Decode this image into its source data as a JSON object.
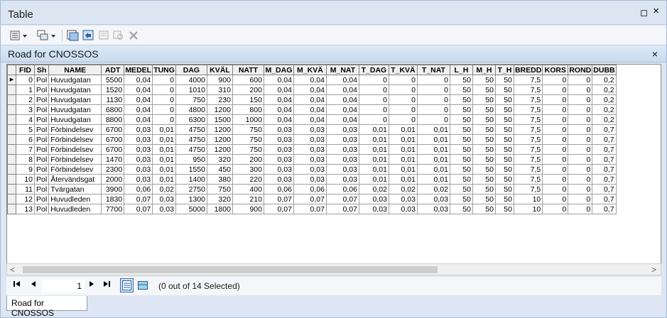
{
  "window": {
    "title": "Table",
    "restore_glyph": "◻",
    "close_glyph": "×"
  },
  "toolbar": {
    "icons": [
      "table-options-icon",
      "related-tables-icon",
      "select-by-attributes-icon",
      "switch-selection-icon",
      "clear-selection-icon",
      "zoom-to-selected-icon",
      "delete-selected-icon"
    ]
  },
  "layer": {
    "name": "Road for CNOSSOS",
    "close_glyph": "×"
  },
  "grid": {
    "columns": [
      "FID",
      "Sh",
      "NAME",
      "ADT",
      "MEDEL",
      "TUNG",
      "DAG",
      "KVÄL",
      "NATT",
      "M_DAG",
      "M_KVÄ",
      "M_NAT",
      "T_DAG",
      "T_KVÄ",
      "T_NAT",
      "L_H",
      "M_H",
      "T_H",
      "BREDD",
      "KORS",
      "ROND",
      "DUBB"
    ],
    "rows": [
      [
        "0",
        "Pol",
        "Huvudgatan",
        "5500",
        "0,04",
        "0",
        "4000",
        "900",
        "600",
        "0,04",
        "0,04",
        "0,04",
        "0",
        "0",
        "0",
        "50",
        "50",
        "50",
        "7,5",
        "0",
        "0",
        "0,2"
      ],
      [
        "1",
        "Pol",
        "Huvudgatan",
        "1520",
        "0,04",
        "0",
        "1010",
        "310",
        "200",
        "0,04",
        "0,04",
        "0,04",
        "0",
        "0",
        "0",
        "50",
        "50",
        "50",
        "7,5",
        "0",
        "0",
        "0,2"
      ],
      [
        "2",
        "Pol",
        "Huvudgatan",
        "1130",
        "0,04",
        "0",
        "750",
        "230",
        "150",
        "0,04",
        "0,04",
        "0,04",
        "0",
        "0",
        "0",
        "50",
        "50",
        "50",
        "7,5",
        "0",
        "0",
        "0,2"
      ],
      [
        "3",
        "Pol",
        "Huvudgatan",
        "6800",
        "0,04",
        "0",
        "4800",
        "1200",
        "800",
        "0,04",
        "0,04",
        "0,04",
        "0",
        "0",
        "0",
        "50",
        "50",
        "50",
        "7,5",
        "0",
        "0",
        "0,2"
      ],
      [
        "4",
        "Pol",
        "Huvudgatan",
        "8800",
        "0,04",
        "0",
        "6300",
        "1500",
        "1000",
        "0,04",
        "0,04",
        "0,04",
        "0",
        "0",
        "0",
        "50",
        "50",
        "50",
        "7,5",
        "0",
        "0",
        "0,2"
      ],
      [
        "5",
        "Pol",
        "Förbindelsev",
        "6700",
        "0,03",
        "0,01",
        "4750",
        "1200",
        "750",
        "0,03",
        "0,03",
        "0,03",
        "0,01",
        "0,01",
        "0,01",
        "50",
        "50",
        "50",
        "7,5",
        "0",
        "0",
        "0,7"
      ],
      [
        "6",
        "Pol",
        "Förbindelsev",
        "6700",
        "0,03",
        "0,01",
        "4750",
        "1200",
        "750",
        "0,03",
        "0,03",
        "0,03",
        "0,01",
        "0,01",
        "0,01",
        "50",
        "50",
        "50",
        "7,5",
        "0",
        "0",
        "0,7"
      ],
      [
        "7",
        "Pol",
        "Förbindelsev",
        "6700",
        "0,03",
        "0,01",
        "4750",
        "1200",
        "750",
        "0,03",
        "0,03",
        "0,03",
        "0,01",
        "0,01",
        "0,01",
        "50",
        "50",
        "50",
        "7,5",
        "0",
        "0",
        "0,7"
      ],
      [
        "8",
        "Pol",
        "Förbindelsev",
        "1470",
        "0,03",
        "0,01",
        "950",
        "320",
        "200",
        "0,03",
        "0,03",
        "0,03",
        "0,01",
        "0,01",
        "0,01",
        "50",
        "50",
        "50",
        "7,5",
        "0",
        "0",
        "0,7"
      ],
      [
        "9",
        "Pol",
        "Förbindelsev",
        "2300",
        "0,03",
        "0,01",
        "1550",
        "450",
        "300",
        "0,03",
        "0,03",
        "0,03",
        "0,01",
        "0,01",
        "0,01",
        "50",
        "50",
        "50",
        "7,5",
        "0",
        "0",
        "0,7"
      ],
      [
        "10",
        "Pol",
        "Återvändsgat",
        "2000",
        "0,03",
        "0,01",
        "1400",
        "380",
        "220",
        "0,03",
        "0,03",
        "0,03",
        "0,01",
        "0,01",
        "0,01",
        "50",
        "50",
        "50",
        "7,5",
        "0",
        "0",
        "0,7"
      ],
      [
        "11",
        "Pol",
        "Tvärgatan",
        "3900",
        "0,06",
        "0,02",
        "2750",
        "750",
        "400",
        "0,06",
        "0,06",
        "0,06",
        "0,02",
        "0,02",
        "0,02",
        "50",
        "50",
        "50",
        "7,5",
        "0",
        "0",
        "0,7"
      ],
      [
        "12",
        "Pol",
        "Huvudleden",
        "1830",
        "0,07",
        "0,03",
        "1300",
        "320",
        "210",
        "0,07",
        "0,07",
        "0,07",
        "0,03",
        "0,03",
        "0,03",
        "50",
        "50",
        "50",
        "10",
        "0",
        "0",
        "0,7"
      ],
      [
        "13",
        "Pol",
        "Huvudleden",
        "7700",
        "0,07",
        "0,03",
        "5000",
        "1800",
        "900",
        "0,07",
        "0,07",
        "0,07",
        "0,03",
        "0,03",
        "0,03",
        "50",
        "50",
        "50",
        "10",
        "0",
        "0",
        "0,7"
      ]
    ],
    "current_row_marker": "▶"
  },
  "navigation": {
    "current_record": "1",
    "status": "(0 out of 14 Selected)"
  },
  "bottom_tab": {
    "label": "Road for CNOSSOS"
  }
}
